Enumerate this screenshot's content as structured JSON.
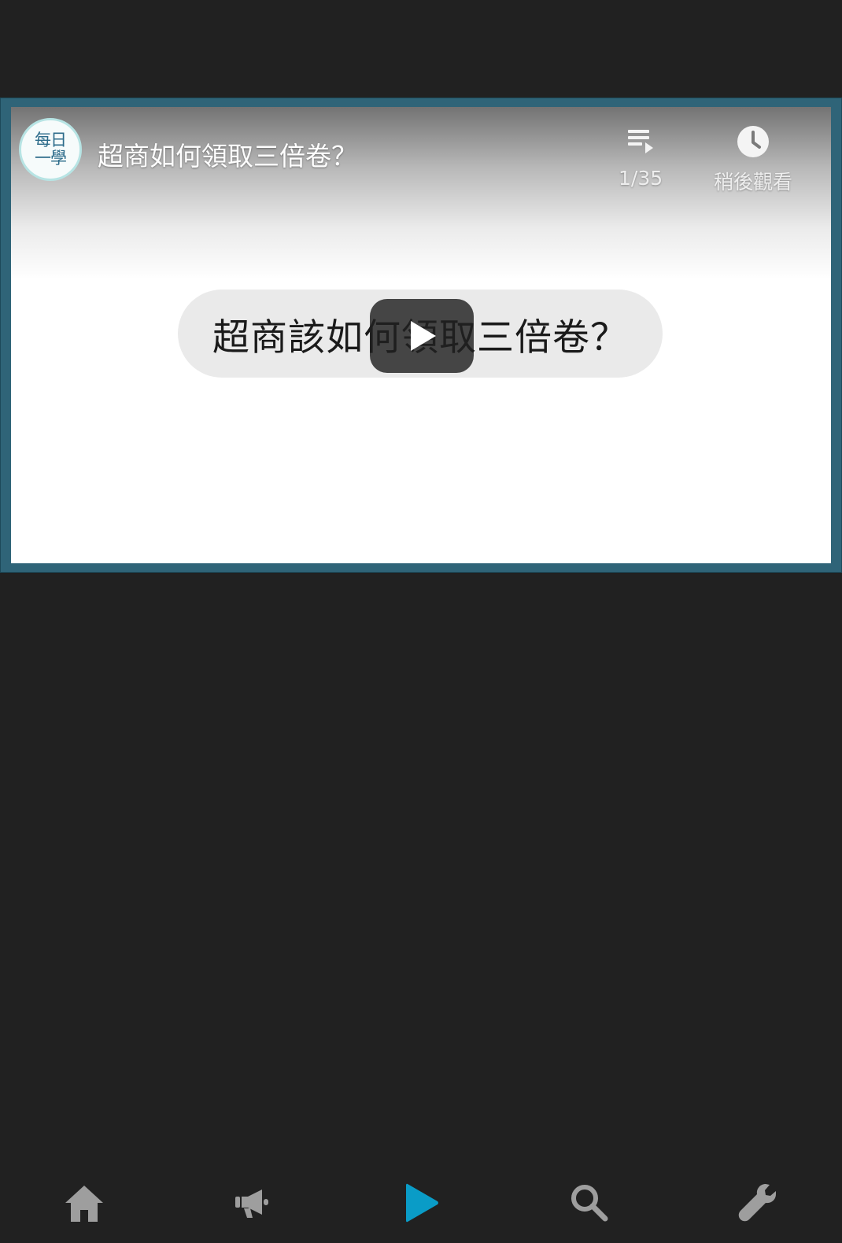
{
  "video": {
    "channel_badge": [
      "每日",
      "一學"
    ],
    "title": "超商如何領取三倍卷？",
    "caption": "超商該如何領取三倍卷？",
    "playlist": {
      "icon": "playlist-icon",
      "position": "1/35"
    },
    "watch_later": {
      "icon": "clock-icon",
      "label": "稍後觀看"
    }
  },
  "bottom_nav": {
    "items": [
      {
        "id": "home",
        "icon": "home-icon"
      },
      {
        "id": "announcements",
        "icon": "megaphone-icon"
      },
      {
        "id": "videos",
        "icon": "play-icon",
        "active": true
      },
      {
        "id": "search",
        "icon": "search-icon"
      },
      {
        "id": "settings",
        "icon": "wrench-icon"
      }
    ],
    "colors": {
      "inactive": "#9e9e9e",
      "active": "#0a9cc7"
    }
  },
  "theme": {
    "background": "#212121",
    "video_frame": "#2f6478"
  }
}
